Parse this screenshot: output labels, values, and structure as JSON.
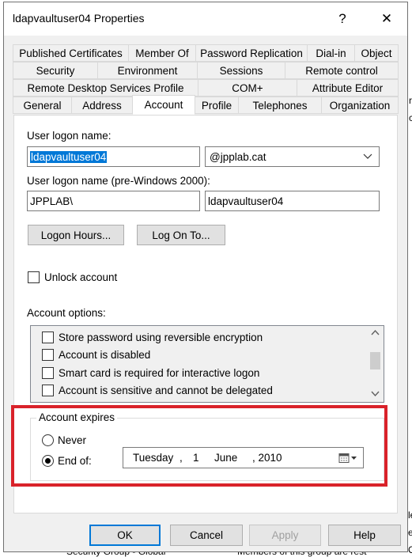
{
  "background": {
    "right_fragments": [
      "r",
      "c",
      "le",
      "e",
      "C"
    ],
    "bottom_left": "Security Group - Global",
    "bottom_right": "Members of this group are rest"
  },
  "dialog": {
    "title": "ldapvaultuser04 Properties",
    "help_glyph": "?",
    "close_glyph": "✕"
  },
  "tabs": {
    "row1": [
      "Published Certificates",
      "Member Of",
      "Password Replication",
      "Dial-in",
      "Object"
    ],
    "row2": [
      "Security",
      "Environment",
      "Sessions",
      "Remote control"
    ],
    "row3": [
      "Remote Desktop Services Profile",
      "COM+",
      "Attribute Editor"
    ],
    "row4": [
      "General",
      "Address",
      "Account",
      "Profile",
      "Telephones",
      "Organization"
    ],
    "active": "Account"
  },
  "account": {
    "logon_name_label": "User logon name:",
    "logon_name_value": "ldapvaultuser04",
    "domain_value": "@jpplab.cat",
    "pre2000_label": "User logon name (pre-Windows 2000):",
    "pre2000_domain": "JPPLAB\\",
    "pre2000_user": "ldapvaultuser04",
    "logon_hours_button": "Logon Hours...",
    "log_on_to_button": "Log On To...",
    "unlock_label": "Unlock account",
    "unlock_checked": false,
    "options_label": "Account options:",
    "options": [
      {
        "label": "Store password using reversible encryption",
        "checked": false
      },
      {
        "label": "Account is disabled",
        "checked": false
      },
      {
        "label": "Smart card is required for interactive logon",
        "checked": false
      },
      {
        "label": "Account is sensitive and cannot be delegated",
        "checked": false
      }
    ],
    "expires": {
      "legend": "Account expires",
      "never_label": "Never",
      "end_of_label": "End of:",
      "selected": "end_of",
      "date": {
        "weekday": "Tuesday",
        "sep1": ",",
        "day": "1",
        "month": "June",
        "year": ", 2010"
      }
    }
  },
  "footer": {
    "ok": "OK",
    "cancel": "Cancel",
    "apply": "Apply",
    "help": "Help"
  },
  "colors": {
    "highlight": "#d9222a",
    "selection": "#0078d7"
  }
}
